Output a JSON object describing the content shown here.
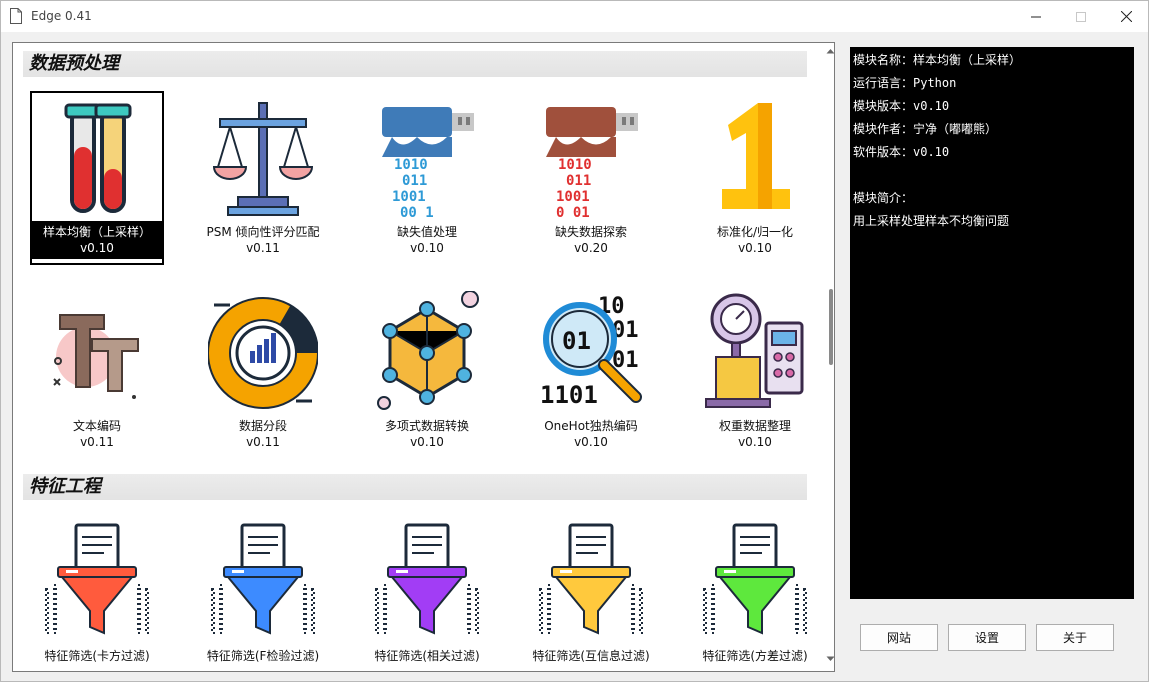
{
  "window": {
    "title": "Edge 0.41"
  },
  "sections": [
    {
      "title": "数据预处理"
    },
    {
      "title": "特征工程"
    }
  ],
  "modules": [
    {
      "name": "样本均衡（上采样）",
      "version": "v0.10",
      "icon": "test-tubes-icon"
    },
    {
      "name": "PSM 倾向性评分匹配",
      "version": "v0.11",
      "icon": "balance-scale-icon"
    },
    {
      "name": "缺失值处理",
      "version": "v0.10",
      "icon": "usb-binary-blue-icon"
    },
    {
      "name": "缺失数据探索",
      "version": "v0.20",
      "icon": "usb-binary-red-icon"
    },
    {
      "name": "标准化/归一化",
      "version": "v0.10",
      "icon": "number-one-icon"
    },
    {
      "name": "文本编码",
      "version": "v0.11",
      "icon": "text-font-icon"
    },
    {
      "name": "数据分段",
      "version": "v0.11",
      "icon": "donut-chart-icon"
    },
    {
      "name": "多项式数据转换",
      "version": "v0.10",
      "icon": "hexagon-network-icon"
    },
    {
      "name": "OneHot独热编码",
      "version": "v0.10",
      "icon": "binary-magnifier-icon"
    },
    {
      "name": "权重数据整理",
      "version": "v0.10",
      "icon": "weighing-scale-icon"
    },
    {
      "name": "特征筛选(卡方过滤)",
      "icon": "funnel-red-icon",
      "color": "#ff5b3d"
    },
    {
      "name": "特征筛选(F检验过滤)",
      "icon": "funnel-blue-icon",
      "color": "#3d8bff"
    },
    {
      "name": "特征筛选(相关过滤)",
      "icon": "funnel-purple-icon",
      "color": "#a23df5"
    },
    {
      "name": "特征筛选(互信息过滤)",
      "icon": "funnel-yellow-icon",
      "color": "#ffc93d"
    },
    {
      "name": "特征筛选(方差过滤)",
      "icon": "funnel-green-icon",
      "color": "#5ee83d"
    }
  ],
  "info": {
    "lines": [
      "模块名称：样本均衡（上采样）",
      "运行语言：Python",
      "模块版本：v0.10",
      "模块作者：宁净（嘟嘟熊）",
      "软件版本：v0.10",
      "",
      "模块简介：",
      "用上采样处理样本不均衡问题"
    ]
  },
  "buttons": {
    "site": "网站",
    "settings": "设置",
    "about": "关于"
  }
}
